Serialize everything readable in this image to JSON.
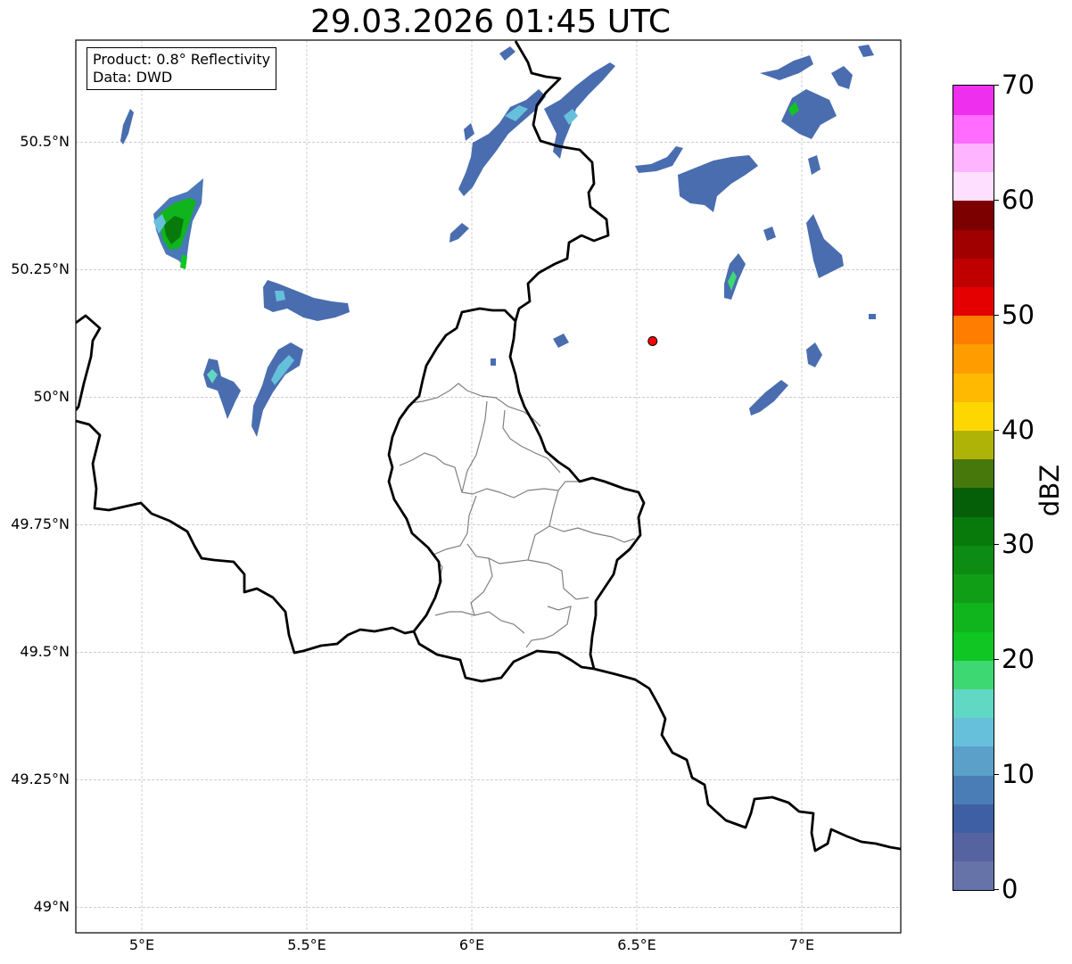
{
  "title": "29.03.2026 01:45 UTC",
  "info": {
    "product": "Product: 0.8° Reflectivity",
    "data": "Data: DWD"
  },
  "map": {
    "lon_range": [
      4.8,
      7.3
    ],
    "lat_range": [
      48.95,
      50.7
    ],
    "lat_ticks": [
      {
        "value": 50.5,
        "label": "50.5°N"
      },
      {
        "value": 50.25,
        "label": "50.25°N"
      },
      {
        "value": 50.0,
        "label": "50°N"
      },
      {
        "value": 49.75,
        "label": "49.75°N"
      },
      {
        "value": 49.5,
        "label": "49.5°N"
      },
      {
        "value": 49.25,
        "label": "49.25°N"
      },
      {
        "value": 49.0,
        "label": "49°N"
      }
    ],
    "lon_ticks": [
      {
        "value": 5.0,
        "label": "5°E"
      },
      {
        "value": 5.5,
        "label": "5.5°E"
      },
      {
        "value": 6.0,
        "label": "6°E"
      },
      {
        "value": 6.5,
        "label": "6.5°E"
      },
      {
        "value": 7.0,
        "label": "7°E"
      }
    ],
    "radar_site": {
      "lon": 6.548,
      "lat": 50.11,
      "color": "#ff0000"
    }
  },
  "colorbar": {
    "label": "dBZ",
    "min": 0,
    "max": 70,
    "step": 2.5,
    "colors": [
      "#6673a8",
      "#5563a0",
      "#3f5fa4",
      "#4a7db5",
      "#5ba0c8",
      "#66c0dc",
      "#61d8c4",
      "#3ed873",
      "#10c622",
      "#10b41c",
      "#109e16",
      "#0c8c12",
      "#087a0c",
      "#055f08",
      "#47780c",
      "#afb307",
      "#ffd700",
      "#ffb900",
      "#ff9d00",
      "#ff7d00",
      "#e40000",
      "#c00000",
      "#a00000",
      "#7d0000",
      "#ffdfff",
      "#ffb4ff",
      "#ff6cff",
      "#ee30ee"
    ],
    "ticks": [
      {
        "value": 0,
        "label": "0"
      },
      {
        "value": 10,
        "label": "10"
      },
      {
        "value": 20,
        "label": "20"
      },
      {
        "value": 30,
        "label": "30"
      },
      {
        "value": 40,
        "label": "40"
      },
      {
        "value": 50,
        "label": "50"
      },
      {
        "value": 60,
        "label": "60"
      },
      {
        "value": 70,
        "label": "70"
      }
    ]
  },
  "echo_colors": {
    "weak": "#4a6db0",
    "light": "#66c0dc",
    "moderate": "#10b41c"
  }
}
